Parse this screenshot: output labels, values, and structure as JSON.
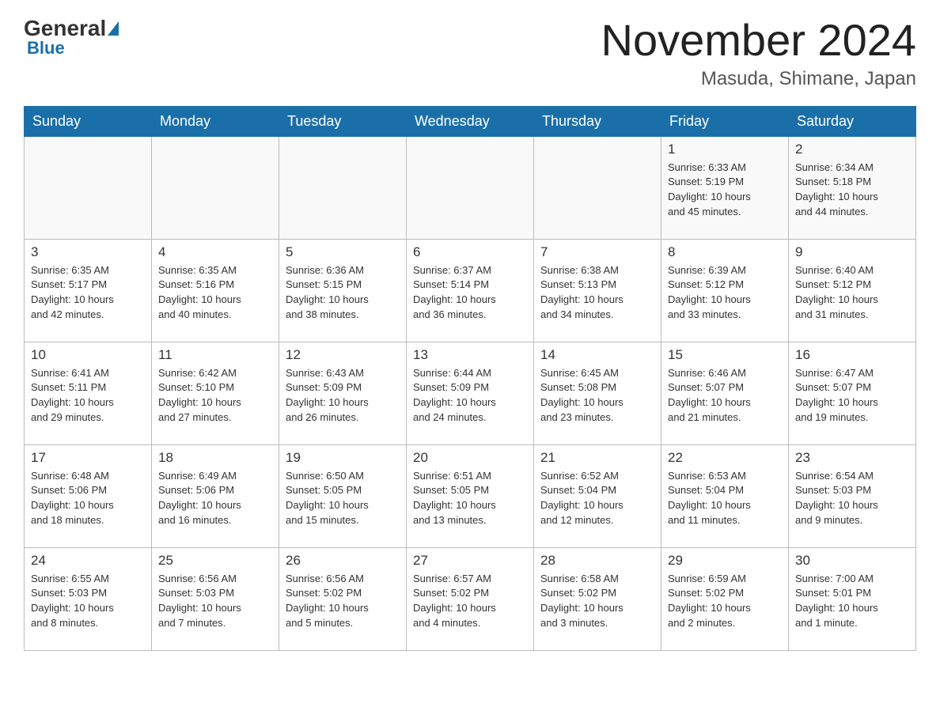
{
  "header": {
    "logo_general": "General",
    "logo_blue": "Blue",
    "month_title": "November 2024",
    "location": "Masuda, Shimane, Japan"
  },
  "weekdays": [
    "Sunday",
    "Monday",
    "Tuesday",
    "Wednesday",
    "Thursday",
    "Friday",
    "Saturday"
  ],
  "weeks": [
    [
      {
        "day": "",
        "info": ""
      },
      {
        "day": "",
        "info": ""
      },
      {
        "day": "",
        "info": ""
      },
      {
        "day": "",
        "info": ""
      },
      {
        "day": "",
        "info": ""
      },
      {
        "day": "1",
        "info": "Sunrise: 6:33 AM\nSunset: 5:19 PM\nDaylight: 10 hours\nand 45 minutes."
      },
      {
        "day": "2",
        "info": "Sunrise: 6:34 AM\nSunset: 5:18 PM\nDaylight: 10 hours\nand 44 minutes."
      }
    ],
    [
      {
        "day": "3",
        "info": "Sunrise: 6:35 AM\nSunset: 5:17 PM\nDaylight: 10 hours\nand 42 minutes."
      },
      {
        "day": "4",
        "info": "Sunrise: 6:35 AM\nSunset: 5:16 PM\nDaylight: 10 hours\nand 40 minutes."
      },
      {
        "day": "5",
        "info": "Sunrise: 6:36 AM\nSunset: 5:15 PM\nDaylight: 10 hours\nand 38 minutes."
      },
      {
        "day": "6",
        "info": "Sunrise: 6:37 AM\nSunset: 5:14 PM\nDaylight: 10 hours\nand 36 minutes."
      },
      {
        "day": "7",
        "info": "Sunrise: 6:38 AM\nSunset: 5:13 PM\nDaylight: 10 hours\nand 34 minutes."
      },
      {
        "day": "8",
        "info": "Sunrise: 6:39 AM\nSunset: 5:12 PM\nDaylight: 10 hours\nand 33 minutes."
      },
      {
        "day": "9",
        "info": "Sunrise: 6:40 AM\nSunset: 5:12 PM\nDaylight: 10 hours\nand 31 minutes."
      }
    ],
    [
      {
        "day": "10",
        "info": "Sunrise: 6:41 AM\nSunset: 5:11 PM\nDaylight: 10 hours\nand 29 minutes."
      },
      {
        "day": "11",
        "info": "Sunrise: 6:42 AM\nSunset: 5:10 PM\nDaylight: 10 hours\nand 27 minutes."
      },
      {
        "day": "12",
        "info": "Sunrise: 6:43 AM\nSunset: 5:09 PM\nDaylight: 10 hours\nand 26 minutes."
      },
      {
        "day": "13",
        "info": "Sunrise: 6:44 AM\nSunset: 5:09 PM\nDaylight: 10 hours\nand 24 minutes."
      },
      {
        "day": "14",
        "info": "Sunrise: 6:45 AM\nSunset: 5:08 PM\nDaylight: 10 hours\nand 23 minutes."
      },
      {
        "day": "15",
        "info": "Sunrise: 6:46 AM\nSunset: 5:07 PM\nDaylight: 10 hours\nand 21 minutes."
      },
      {
        "day": "16",
        "info": "Sunrise: 6:47 AM\nSunset: 5:07 PM\nDaylight: 10 hours\nand 19 minutes."
      }
    ],
    [
      {
        "day": "17",
        "info": "Sunrise: 6:48 AM\nSunset: 5:06 PM\nDaylight: 10 hours\nand 18 minutes."
      },
      {
        "day": "18",
        "info": "Sunrise: 6:49 AM\nSunset: 5:06 PM\nDaylight: 10 hours\nand 16 minutes."
      },
      {
        "day": "19",
        "info": "Sunrise: 6:50 AM\nSunset: 5:05 PM\nDaylight: 10 hours\nand 15 minutes."
      },
      {
        "day": "20",
        "info": "Sunrise: 6:51 AM\nSunset: 5:05 PM\nDaylight: 10 hours\nand 13 minutes."
      },
      {
        "day": "21",
        "info": "Sunrise: 6:52 AM\nSunset: 5:04 PM\nDaylight: 10 hours\nand 12 minutes."
      },
      {
        "day": "22",
        "info": "Sunrise: 6:53 AM\nSunset: 5:04 PM\nDaylight: 10 hours\nand 11 minutes."
      },
      {
        "day": "23",
        "info": "Sunrise: 6:54 AM\nSunset: 5:03 PM\nDaylight: 10 hours\nand 9 minutes."
      }
    ],
    [
      {
        "day": "24",
        "info": "Sunrise: 6:55 AM\nSunset: 5:03 PM\nDaylight: 10 hours\nand 8 minutes."
      },
      {
        "day": "25",
        "info": "Sunrise: 6:56 AM\nSunset: 5:03 PM\nDaylight: 10 hours\nand 7 minutes."
      },
      {
        "day": "26",
        "info": "Sunrise: 6:56 AM\nSunset: 5:02 PM\nDaylight: 10 hours\nand 5 minutes."
      },
      {
        "day": "27",
        "info": "Sunrise: 6:57 AM\nSunset: 5:02 PM\nDaylight: 10 hours\nand 4 minutes."
      },
      {
        "day": "28",
        "info": "Sunrise: 6:58 AM\nSunset: 5:02 PM\nDaylight: 10 hours\nand 3 minutes."
      },
      {
        "day": "29",
        "info": "Sunrise: 6:59 AM\nSunset: 5:02 PM\nDaylight: 10 hours\nand 2 minutes."
      },
      {
        "day": "30",
        "info": "Sunrise: 7:00 AM\nSunset: 5:01 PM\nDaylight: 10 hours\nand 1 minute."
      }
    ]
  ]
}
